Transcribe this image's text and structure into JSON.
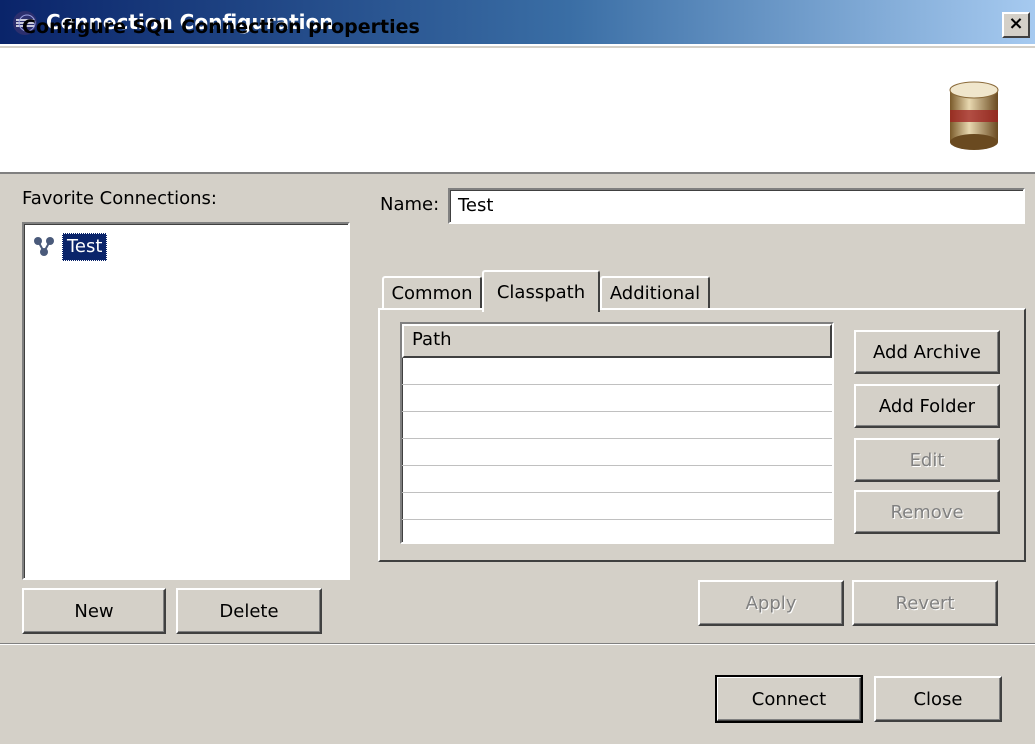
{
  "window": {
    "title": "Connection Configuration",
    "close_glyph": "×"
  },
  "header": {
    "title": "Configure SQL Connection properties",
    "icon": "database-icon"
  },
  "favorites": {
    "label": "Favorite Connections:",
    "items": [
      {
        "label": "Test",
        "icon": "connection-icon",
        "selected": true
      }
    ],
    "new_label": "New",
    "delete_label": "Delete"
  },
  "name": {
    "label": "Name:",
    "value": "Test"
  },
  "tabs": [
    {
      "label": "Common",
      "active": false
    },
    {
      "label": "Classpath",
      "active": true
    },
    {
      "label": "Additional",
      "active": false
    }
  ],
  "classpath": {
    "column_header": "Path",
    "rows": [],
    "buttons": {
      "add_archive": "Add Archive",
      "add_folder": "Add Folder",
      "edit": "Edit",
      "remove": "Remove"
    }
  },
  "actions": {
    "apply": "Apply",
    "revert": "Revert",
    "connect": "Connect",
    "close": "Close"
  },
  "colors": {
    "title_bar": "#0a246a",
    "selection": "#0a246a",
    "dialog_bg": "#d4d0c8"
  }
}
